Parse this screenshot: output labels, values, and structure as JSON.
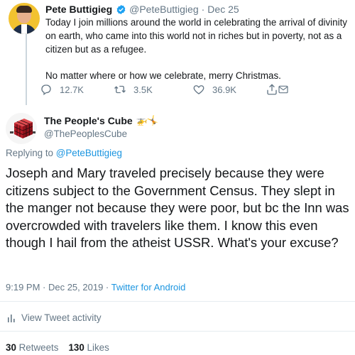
{
  "parent_tweet": {
    "author_name": "Pete Buttigieg",
    "handle": "@PeteButtigieg",
    "separator": "·",
    "date": "Dec 25",
    "text_p1": "Today I join millions around the world in celebrating the arrival of divinity on earth, who came into this world not in riches but in poverty, not as a citizen but as a refugee.",
    "text_p2": "No matter where or how we celebrate, merry Christmas.",
    "reply_count": "12.7K",
    "retweet_count": "3.5K",
    "like_count": "36.9K"
  },
  "reply_tweet": {
    "author_name": "The People's Cube",
    "badges": "🚁🤸",
    "handle": "@ThePeoplesCube",
    "replying_prefix": "Replying to",
    "replying_to": "@PeteButtigieg",
    "text": "Joseph and Mary traveled precisely because they were citizens subject to the Government Census. They slept in the manger not because they were poor, but bc the Inn was overcrowded with travelers like them. I know this even though I hail from the atheist USSR. What's your excuse?",
    "timestamp": "9:19 PM · Dec 25, 2019 · ",
    "client": "Twitter for Android",
    "activity_label": "View Tweet activity",
    "retweets_count": "30",
    "retweets_label": "Retweets",
    "likes_count": "130",
    "likes_label": "Likes"
  },
  "colors": {
    "accent": "#1b95e0",
    "muted": "#657786",
    "verified": "#1da1f2",
    "cube_red": "#c8202c"
  },
  "icons": [
    "verified-badge-icon",
    "reply-icon",
    "retweet-icon",
    "like-icon",
    "share-icon",
    "activity-icon"
  ]
}
